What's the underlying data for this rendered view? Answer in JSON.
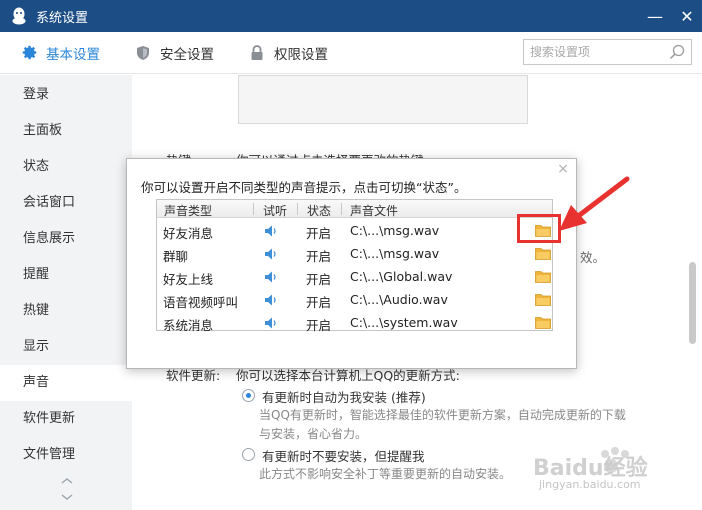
{
  "window": {
    "title": "系统设置",
    "min_label": "—",
    "close_label": "✕"
  },
  "toolbar": {
    "tabs": [
      {
        "label": "基本设置",
        "icon": "gear-icon",
        "active": true
      },
      {
        "label": "安全设置",
        "icon": "shield-icon",
        "active": false
      },
      {
        "label": "权限设置",
        "icon": "lock-icon",
        "active": false
      }
    ],
    "search_placeholder": "搜索设置项"
  },
  "sidebar": {
    "items": [
      {
        "label": "登录"
      },
      {
        "label": "主面板"
      },
      {
        "label": "状态"
      },
      {
        "label": "会话窗口"
      },
      {
        "label": "信息展示"
      },
      {
        "label": "提醒"
      },
      {
        "label": "热键"
      },
      {
        "label": "显示"
      },
      {
        "label": "声音",
        "active": true
      },
      {
        "label": "软件更新"
      },
      {
        "label": "文件管理"
      }
    ]
  },
  "content": {
    "hotkey_label": "热键:",
    "hotkey_desc": "你可以通过点击选择要更改的热键",
    "effect_tail": "效。",
    "update_label": "软件更新:",
    "update_desc": "你可以选择本台计算机上QQ的更新方式:",
    "option1_label": "有更新时自动为我安装 (推荐)",
    "option1_desc_line1": "当QQ有更新时，智能选择最佳的软件更新方案，自动完成更新的下载",
    "option1_desc_line2": "与安装，省心省力。",
    "option2_label": "有更新时不要安装，但提醒我",
    "option2_desc": "此方式不影响安全补丁等重要更新的自动安装。"
  },
  "dialog": {
    "message": "你可以设置开启不同类型的声音提示，点击可切换“状态”。",
    "close_label": "×",
    "columns": [
      "声音类型",
      "试听",
      "状态",
      "声音文件"
    ],
    "rows": [
      {
        "type": "好友消息",
        "status": "开启",
        "file": "C:\\...\\msg.wav"
      },
      {
        "type": "群聊",
        "status": "开启",
        "file": "C:\\...\\msg.wav"
      },
      {
        "type": "好友上线",
        "status": "开启",
        "file": "C:\\...\\Global.wav"
      },
      {
        "type": "语音视频呼叫",
        "status": "开启",
        "file": "C:\\...\\Audio.wav"
      },
      {
        "type": "系统消息",
        "status": "开启",
        "file": "C:\\...\\system.wav"
      }
    ]
  },
  "watermark": {
    "brand": "Baidu经验",
    "url": "jingyan.baidu.com"
  },
  "colors": {
    "titlebar": "#1c4d85",
    "accent": "#2a86d8",
    "highlight": "#e8322f",
    "folder": "#f0b43a"
  }
}
